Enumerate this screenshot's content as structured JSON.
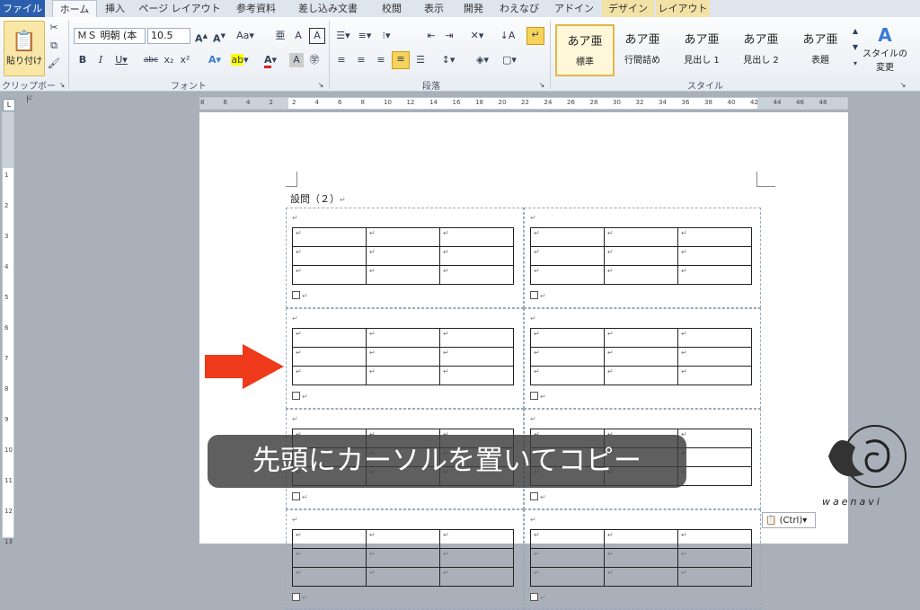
{
  "tabs": [
    {
      "label": "ファイル",
      "kind": "file"
    },
    {
      "label": "ホーム",
      "kind": "active"
    },
    {
      "label": "挿入",
      "kind": ""
    },
    {
      "label": "ページ レイアウト",
      "kind": ""
    },
    {
      "label": "参考資料",
      "kind": ""
    },
    {
      "label": "差し込み文書",
      "kind": ""
    },
    {
      "label": "校閲",
      "kind": ""
    },
    {
      "label": "表示",
      "kind": ""
    },
    {
      "label": "開発",
      "kind": ""
    },
    {
      "label": "わえなび",
      "kind": ""
    },
    {
      "label": "アドイン",
      "kind": ""
    },
    {
      "label": "デザイン",
      "kind": "ctx"
    },
    {
      "label": "レイアウト",
      "kind": "ctx"
    }
  ],
  "clipboard": {
    "paste_label": "貼り付け",
    "group_label": "クリップボード"
  },
  "font": {
    "name": "ＭＳ 明朝 (本",
    "size": "10.5",
    "group_label": "フォント"
  },
  "paragraph": {
    "group_label": "段落"
  },
  "styles": {
    "group_label": "スタイル",
    "sample": "あア亜",
    "items": [
      "標準",
      "行間詰め",
      "見出し 1",
      "見出し 2",
      "表題"
    ],
    "change_label_1": "スタイルの",
    "change_label_2": "変更"
  },
  "ruler": {
    "h_labels": [
      "8",
      "6",
      "4",
      "2",
      "2",
      "4",
      "6",
      "8",
      "10",
      "12",
      "14",
      "16",
      "18",
      "20",
      "22",
      "24",
      "26",
      "28",
      "30",
      "32",
      "34",
      "36",
      "38",
      "40",
      "42",
      "44",
      "46",
      "48"
    ],
    "v_labels": [
      "1",
      "2",
      "3",
      "4",
      "5",
      "6",
      "7",
      "8",
      "9",
      "10",
      "11",
      "12",
      "13"
    ]
  },
  "document": {
    "heading": "設問（２）",
    "return_mark": "↵"
  },
  "caption": "先頭にカーソルを置いてコピー",
  "logo_text": "waenavi",
  "paste_options": "(Ctrl)",
  "colors": {
    "file_tab": "#2b5fae",
    "arrow": "#ee3a1a",
    "context_tab": "#f3e2a6"
  }
}
